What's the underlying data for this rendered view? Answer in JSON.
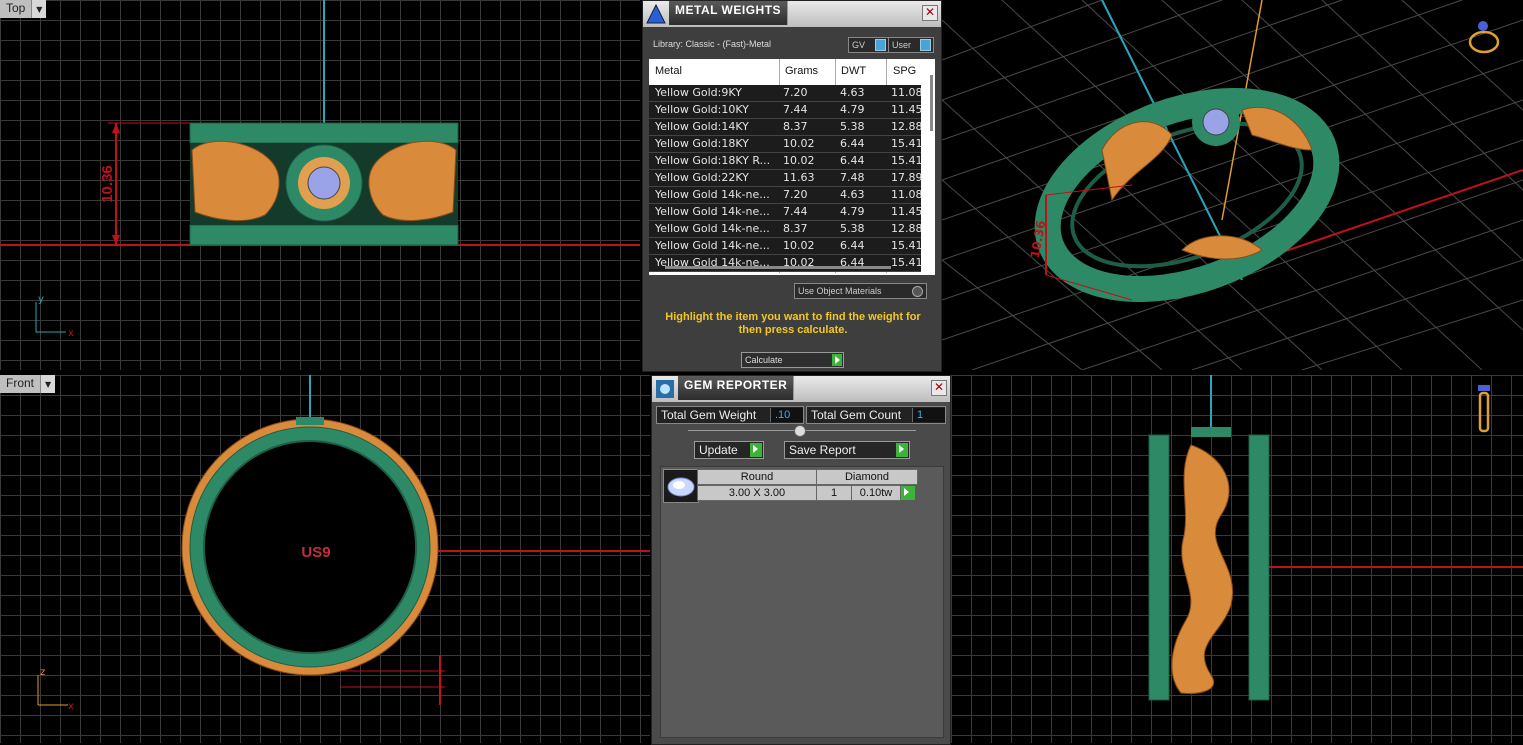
{
  "viewports": {
    "top": {
      "label": "Top",
      "dimension": "10.36"
    },
    "front": {
      "label": "Front",
      "size_label": "US9"
    },
    "perspective": {
      "dimension": "10.36"
    }
  },
  "axis": {
    "x": "x",
    "y": "y",
    "z": "z"
  },
  "metal_weights": {
    "title": "METAL WEIGHTS",
    "library": "Library: Classic - (Fast)-Metal",
    "toggle_gv": "GV",
    "toggle_user": "User",
    "columns": [
      "Metal",
      "Grams",
      "DWT",
      "SPG"
    ],
    "rows": [
      [
        "Yellow Gold:9KY",
        "7.20",
        "4.63",
        "11.08"
      ],
      [
        "Yellow Gold:10KY",
        "7.44",
        "4.79",
        "11.45"
      ],
      [
        "Yellow Gold:14KY",
        "8.37",
        "5.38",
        "12.88"
      ],
      [
        "Yellow Gold:18KY",
        "10.02",
        "6.44",
        "15.41"
      ],
      [
        "Yellow Gold:18KY R...",
        "10.02",
        "6.44",
        "15.41"
      ],
      [
        "Yellow Gold:22KY",
        "11.63",
        "7.48",
        "17.89"
      ],
      [
        "Yellow Gold 14k-ne...",
        "7.20",
        "4.63",
        "11.08"
      ],
      [
        "Yellow Gold 14k-ne...",
        "7.44",
        "4.79",
        "11.45"
      ],
      [
        "Yellow Gold 14k-ne...",
        "8.37",
        "5.38",
        "12.88"
      ],
      [
        "Yellow Gold 14k-ne...",
        "10.02",
        "6.44",
        "15.41"
      ],
      [
        "Yellow Gold 14k-ne...",
        "10.02",
        "6.44",
        "15.41"
      ]
    ],
    "use_object_materials": "Use Object Materials",
    "hint": "Highlight the item you want to find the weight for then press calculate.",
    "calculate": "Calculate"
  },
  "gem_reporter": {
    "title": "GEM REPORTER",
    "total_weight_label": "Total Gem Weight",
    "total_weight_value": ".10",
    "total_count_label": "Total Gem Count",
    "total_count_value": "1",
    "update": "Update",
    "save_report": "Save Report",
    "table": {
      "shape_header": "Round",
      "material_header": "Diamond",
      "size": "3.00 X 3.00",
      "count": "1",
      "weight": "0.10tw"
    }
  },
  "colors": {
    "ring_green": "#2e8a66",
    "dragon_orange": "#d98a3a",
    "dim_red": "#c0101a",
    "axis_cyan": "#2aa6b8",
    "hint_yellow": "#f3c823"
  }
}
